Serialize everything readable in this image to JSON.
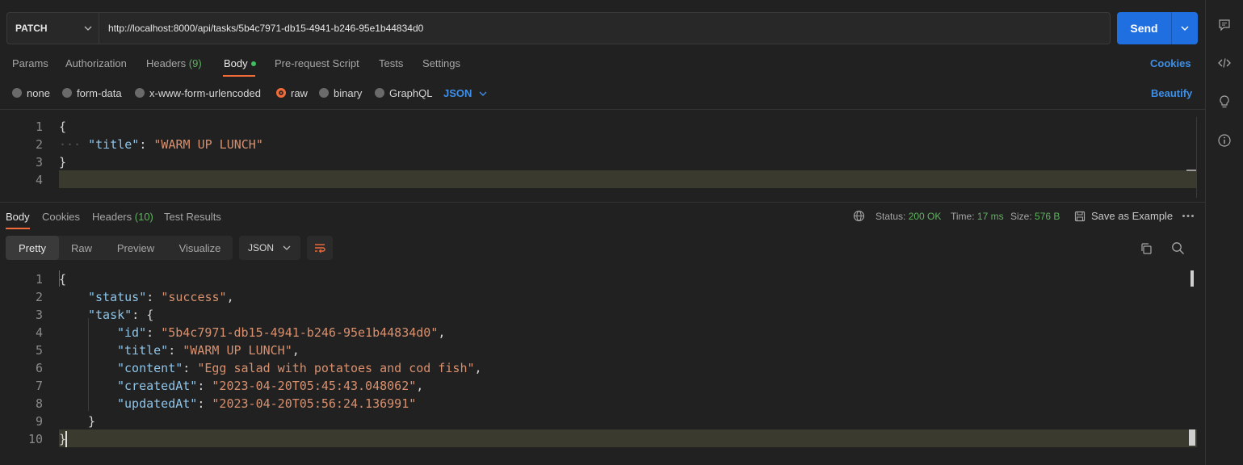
{
  "request": {
    "method": "PATCH",
    "url": "http://localhost:8000/api/tasks/5b4c7971-db15-4941-b246-95e1b44834d0",
    "send_label": "Send"
  },
  "request_tabs": {
    "params": "Params",
    "authorization": "Authorization",
    "headers": "Headers",
    "headers_count": "(9)",
    "body": "Body",
    "pre_request": "Pre-request Script",
    "tests": "Tests",
    "settings": "Settings",
    "cookies": "Cookies"
  },
  "body_types": {
    "none": "none",
    "form_data": "form-data",
    "urlencoded": "x-www-form-urlencoded",
    "raw": "raw",
    "binary": "binary",
    "graphql": "GraphQL",
    "selected_format": "JSON",
    "beautify": "Beautify"
  },
  "request_body": {
    "line_numbers": [
      "1",
      "2",
      "3",
      "4"
    ],
    "open_brace": "{",
    "title_key": "\"title\"",
    "title_value": "\"WARM UP LUNCH\"",
    "close_brace": "}"
  },
  "response_tabs": {
    "body": "Body",
    "cookies": "Cookies",
    "headers": "Headers",
    "headers_count": "(10)",
    "test_results": "Test Results"
  },
  "response_meta": {
    "status_label": "Status:",
    "status_value": "200 OK",
    "time_label": "Time:",
    "time_value": "17 ms",
    "size_label": "Size:",
    "size_value": "576 B",
    "save_example": "Save as Example"
  },
  "view_modes": {
    "pretty": "Pretty",
    "raw": "Raw",
    "preview": "Preview",
    "visualize": "Visualize",
    "format": "JSON"
  },
  "response_body": {
    "line_numbers": [
      "1",
      "2",
      "3",
      "4",
      "5",
      "6",
      "7",
      "8",
      "9",
      "10"
    ],
    "status_key": "\"status\"",
    "status_value": "\"success\"",
    "task_key": "\"task\"",
    "id_key": "\"id\"",
    "id_value": "\"5b4c7971-db15-4941-b246-95e1b44834d0\"",
    "title_key": "\"title\"",
    "title_value": "\"WARM UP LUNCH\"",
    "content_key": "\"content\"",
    "content_value": "\"Egg salad with potatoes and cod fish\"",
    "created_key": "\"createdAt\"",
    "created_value": "\"2023-04-20T05:45:43.048062\"",
    "updated_key": "\"updatedAt\"",
    "updated_value": "\"2023-04-20T05:56:24.136991\""
  },
  "icons": {
    "rail": [
      "comment-icon",
      "code-icon",
      "lightbulb-icon",
      "info-icon"
    ],
    "accent": "#f26b3a",
    "send_blue": "#1f6fe0",
    "ok_green": "#5fb35f"
  }
}
